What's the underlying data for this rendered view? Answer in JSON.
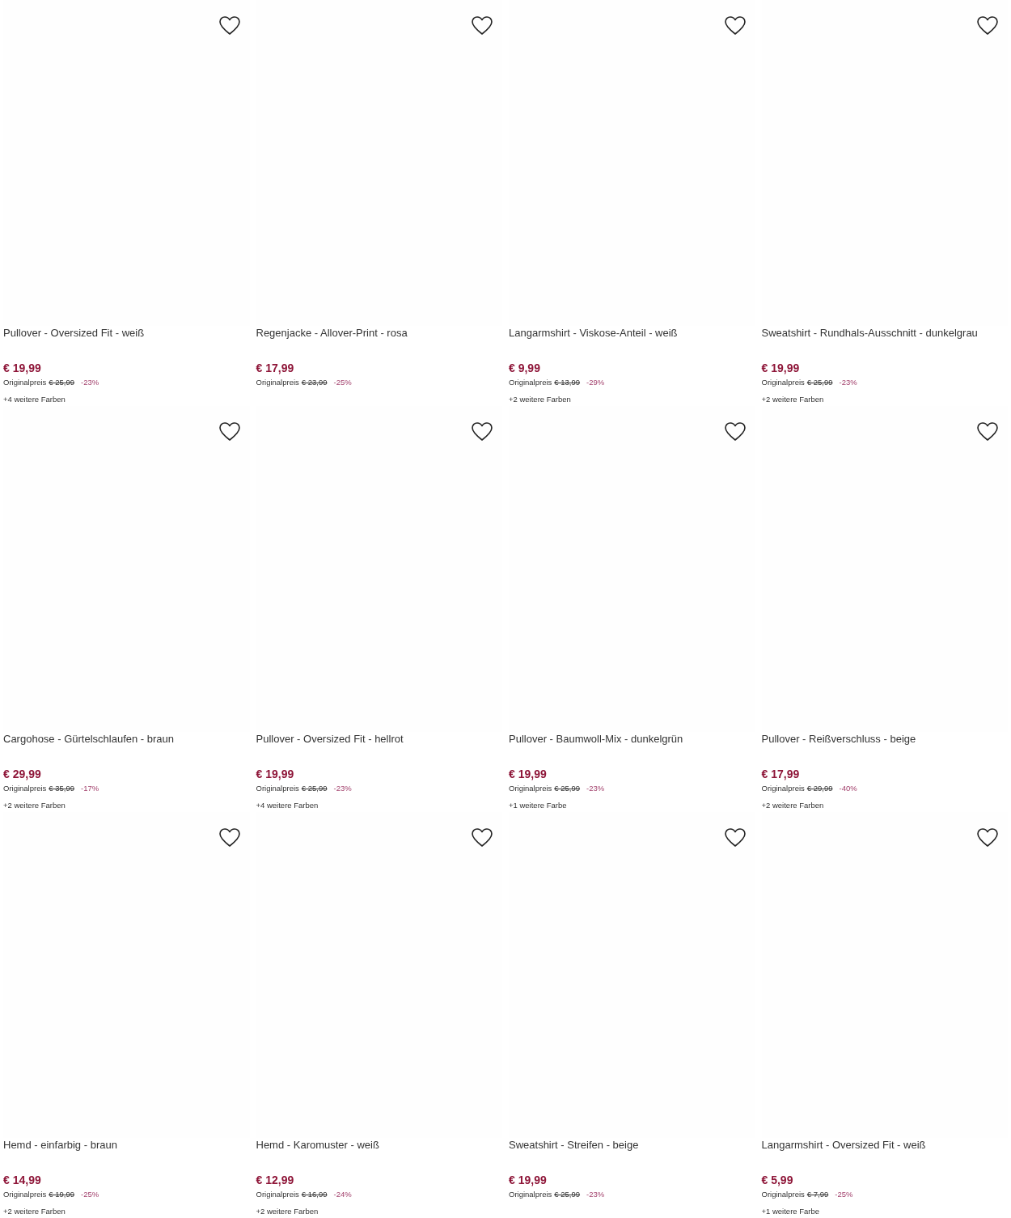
{
  "products": [
    {
      "title": "Pullover - Oversized Fit - weiß",
      "price": "€ 19,99",
      "original_label": "Originalpreis",
      "original_price": "€ 25,99",
      "discount": "-23%",
      "colors": "+4 weitere Farben"
    },
    {
      "title": "Regenjacke - Allover-Print - rosa",
      "price": "€ 17,99",
      "original_label": "Originalpreis",
      "original_price": "€ 23,99",
      "discount": "-25%"
    },
    {
      "title": "Langarmshirt - Viskose-Anteil - weiß",
      "price": "€ 9,99",
      "original_label": "Originalpreis",
      "original_price": "€ 13,99",
      "discount": "-29%",
      "colors": "+2 weitere Farben"
    },
    {
      "title": "Sweatshirt - Rundhals-Ausschnitt - dunkelgrau",
      "price": "€ 19,99",
      "original_label": "Originalpreis",
      "original_price": "€ 25,99",
      "discount": "-23%",
      "colors": "+2 weitere Farben"
    },
    {
      "title": "Cargohose - Gürtelschlaufen - braun",
      "price": "€ 29,99",
      "original_label": "Originalpreis",
      "original_price": "€ 35,99",
      "discount": "-17%",
      "colors": "+2 weitere Farben"
    },
    {
      "title": "Pullover - Oversized Fit - hellrot",
      "price": "€ 19,99",
      "original_label": "Originalpreis",
      "original_price": "€ 25,99",
      "discount": "-23%",
      "colors": "+4 weitere Farben"
    },
    {
      "title": "Pullover - Baumwoll-Mix - dunkelgrün",
      "price": "€ 19,99",
      "original_label": "Originalpreis",
      "original_price": "€ 25,99",
      "discount": "-23%",
      "colors": "+1 weitere Farbe"
    },
    {
      "title": "Pullover - Reißverschluss - beige",
      "price": "€ 17,99",
      "original_label": "Originalpreis",
      "original_price": "€ 29,99",
      "discount": "-40%",
      "colors": "+2 weitere Farben"
    },
    {
      "title": "Hemd - einfarbig - braun",
      "price": "€ 14,99",
      "original_label": "Originalpreis",
      "original_price": "€ 19,99",
      "discount": "-25%",
      "colors": "+2 weitere Farben"
    },
    {
      "title": "Hemd - Karomuster - weiß",
      "price": "€ 12,99",
      "original_label": "Originalpreis",
      "original_price": "€ 16,99",
      "discount": "-24%",
      "colors": "+2 weitere Farben"
    },
    {
      "title": "Sweatshirt - Streifen - beige",
      "price": "€ 19,99",
      "original_label": "Originalpreis",
      "original_price": "€ 25,99",
      "discount": "-23%"
    },
    {
      "title": "Langarmshirt - Oversized Fit - weiß",
      "price": "€ 5,99",
      "original_label": "Originalpreis",
      "original_price": "€ 7,99",
      "discount": "-25%",
      "colors": "+1 weitere Farbe"
    }
  ]
}
